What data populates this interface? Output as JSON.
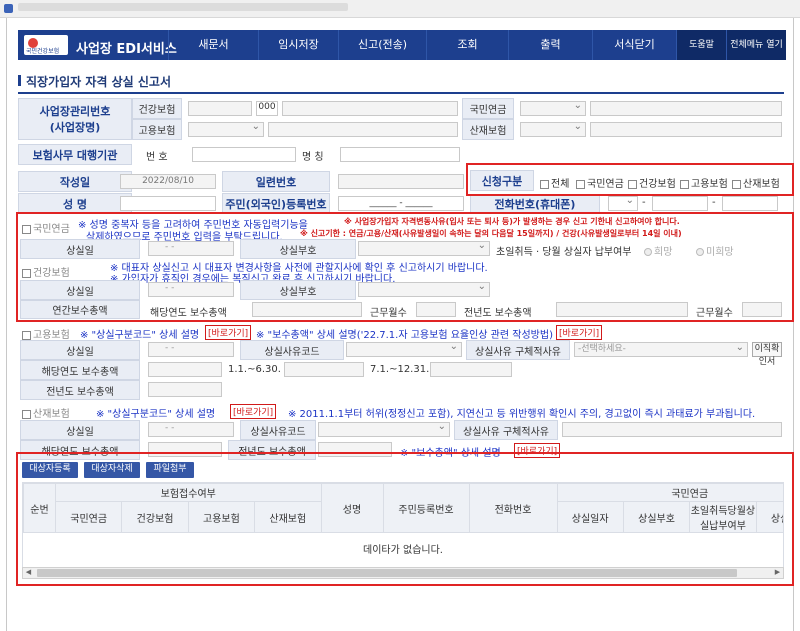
{
  "window": {
    "title": "사업장 EDI서비스"
  },
  "nav": {
    "logo_text": "국민건강보험",
    "brand": "사업장 EDI서비스",
    "items": [
      "새문서",
      "임시저장",
      "신고(전송)",
      "조회",
      "출력",
      "서식닫기"
    ],
    "help": "도움말",
    "all_menu": "전체메뉴 열기"
  },
  "page_title": "직장가입자 자격 상실 신고서",
  "employer": {
    "label_number": "사업장관리번호",
    "label_name": "(사업장명)",
    "health": "건강보험",
    "employment": "고용보험",
    "pension": "국민연금",
    "industrial": "산재보험",
    "health_code": "000"
  },
  "agent": {
    "label": "보험사무 대행기관",
    "number_label": "번 호",
    "name_label": "명 칭"
  },
  "form": {
    "date_label": "작성일",
    "date_value": "2022/08/10",
    "serial_label": "일련번호",
    "name_label": "성 명",
    "rrn_label": "주민(외국인)등록번호",
    "rrn_value": "______ - ______",
    "phone_label": "전화번호(휴대폰)",
    "phone_dash": "-"
  },
  "category": {
    "label": "신청구분",
    "options": [
      "전체",
      "국민연금",
      "건강보험",
      "고용보험",
      "산재보험"
    ]
  },
  "pension": {
    "label": "국민연금",
    "note1": "※ 성명 중복자 등을 고려하여 주민번호 자동입력기능을",
    "note2": "삭제하였으므로 주민번호 입력을 부탁드립니다.",
    "note3": "※ 사업장가입자 자격변동사유(입사 또는 퇴사 등)가 발생하는 경우 신고 기한내 신고하여야 합니다.",
    "note4": "※ 신고기한 : 연금/고용/산재(사유발생일이 속하는 달의 다음달 15일까지) / 건강(사유발생일로부터 14일 이내)",
    "loss_date": "상실일",
    "loss_code": "상실부호",
    "first_month": "초일취득 · 당월 상실자 납부여부",
    "opt_yes": "희망",
    "opt_no": "미희망",
    "dash": "- -"
  },
  "health": {
    "label": "건강보험",
    "note1": "※ 대표자 상실신고 시 대표자 변경사항을 사전에 관할지사에 확인 후 신고하시기 바랍니다.",
    "note2": "※ 가입자가 휴직인 경우에는 복직신고 완료 후 신고하시기 바랍니다.",
    "loss_date": "상실일",
    "loss_code": "상실부호",
    "annual_total": "연간보수총액",
    "this_year": "해당연도 보수총액",
    "months": "근무월수",
    "last_year": "전년도 보수총액",
    "months2": "근무월수"
  },
  "employment": {
    "label": "고용보험",
    "note1": "※ \"상실구분코드\" 상세 설명",
    "link": "[바로가기]",
    "note2": "※ \"보수총액\" 상세 설명('22.7.1.자 고용보험 요율인상 관련 작성방법)",
    "loss_date": "상실일",
    "reason_code": "상실사유코드",
    "detail": "상실사유 구체적사유",
    "detail_placeholder": "-선택하세요-",
    "confirm_btn": "이직확인서",
    "this_year": "해당연도 보수총액",
    "period1": "1.1.~6.30.",
    "period2": "7.1.~12.31.",
    "last_year": "전년도 보수총액"
  },
  "industrial": {
    "label": "산재보험",
    "note1": "※ \"상실구분코드\" 상세 설명",
    "link": "[바로가기]",
    "note2": "※ 2011.1.1부터 허위(정정신고 포함), 지연신고 등 위반행위 확인시 주의, 경고없이 즉시 과태료가 부과됩니다.",
    "loss_date": "상실일",
    "reason_code": "상실사유코드",
    "detail": "상실사유 구체적사유",
    "this_year": "해당연도 보수총액",
    "last_year": "전년도 보수총액",
    "note3": "※ \"보수총액\" 상세 설명",
    "link2": "[바로가기]"
  },
  "actions": {
    "register": "대상자등록",
    "delete": "대상자삭제",
    "attach": "파일첨부"
  },
  "grid": {
    "col_no": "순번",
    "col_receipt": "보험접수여부",
    "sub_receipt": [
      "국민연금",
      "건강보험",
      "고용보험",
      "산재보험"
    ],
    "col_name": "성명",
    "col_rrn": "주민등록번호",
    "col_phone": "전화번호",
    "col_pension": "국민연금",
    "sub_pension": [
      "상실일자",
      "상실부호",
      "초일취득당월상실납부여부",
      "상실일자"
    ],
    "empty": "데이타가 없습니다."
  }
}
